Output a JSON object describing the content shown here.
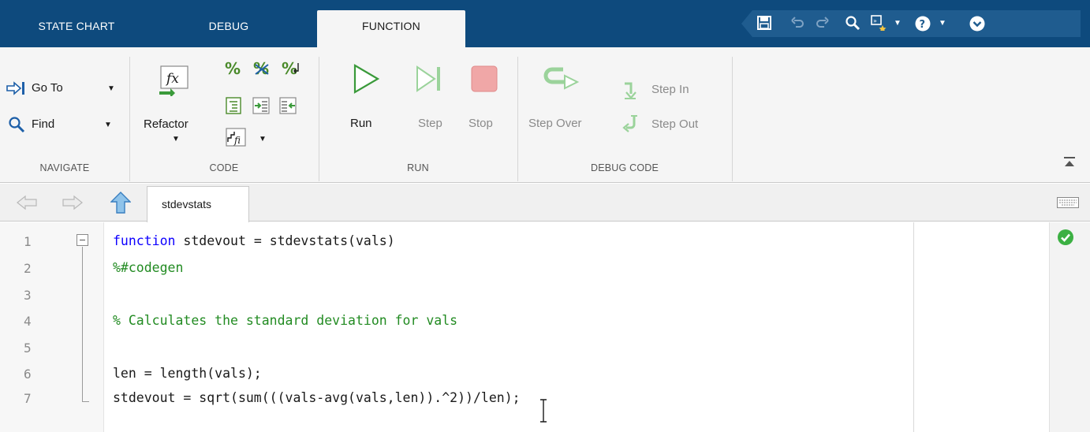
{
  "tabs": [
    {
      "label": "STATE CHART",
      "active": false
    },
    {
      "label": "DEBUG",
      "active": false
    },
    {
      "label": "FUNCTION",
      "active": true
    }
  ],
  "quick_access": [
    "save-icon",
    "undo-icon",
    "redo-icon",
    "search-icon",
    "shortcuts-icon",
    "help-icon",
    "options-icon"
  ],
  "ribbon": {
    "navigate": {
      "go_to": "Go To",
      "find": "Find",
      "label": "NAVIGATE"
    },
    "code": {
      "refactor": "Refactor",
      "label": "CODE"
    },
    "run": {
      "run": "Run",
      "step": "Step",
      "stop": "Stop",
      "label": "RUN"
    },
    "debug_code": {
      "step_over": "Step Over",
      "step_in": "Step In",
      "step_out": "Step Out",
      "label": "DEBUG CODE"
    }
  },
  "editor": {
    "file_tab": "stdevstats",
    "lines": [
      {
        "num": "1",
        "parts": [
          {
            "t": "function",
            "c": "kw"
          },
          {
            "t": " stdevout = stdevstats(vals)",
            "c": ""
          }
        ]
      },
      {
        "num": "2",
        "parts": [
          {
            "t": "%#codegen",
            "c": "cm"
          }
        ]
      },
      {
        "num": "3",
        "parts": []
      },
      {
        "num": "4",
        "parts": [
          {
            "t": "% Calculates the standard deviation for vals",
            "c": "cm"
          }
        ]
      },
      {
        "num": "5",
        "parts": []
      },
      {
        "num": "6",
        "parts": [
          {
            "t": "len = length(vals);",
            "c": ""
          }
        ]
      },
      {
        "num": "7",
        "parts": [
          {
            "t": "stdevout = sqrt(sum(((vals-avg(vals,len)).^2))/len);",
            "c": ""
          }
        ]
      }
    ]
  },
  "colors": {
    "tabstrip": "#0e4a7d",
    "keyword": "#0e00ff",
    "comment": "#228b22",
    "ok_status": "#3cb043"
  }
}
